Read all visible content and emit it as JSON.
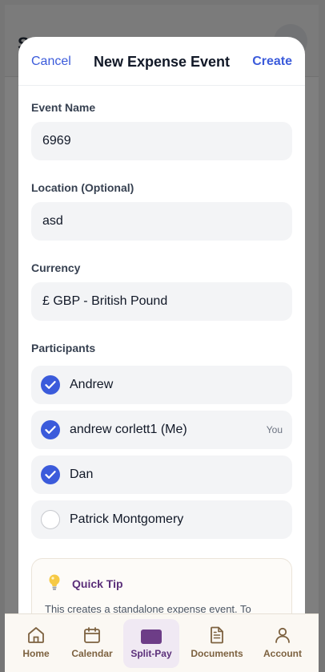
{
  "background": {
    "title": "Split-Pay"
  },
  "header": {
    "cancel": "Cancel",
    "title": "New Expense Event",
    "create": "Create"
  },
  "form": {
    "event_name": {
      "label": "Event Name",
      "value": "6969"
    },
    "location": {
      "label": "Location (Optional)",
      "value": "asd"
    },
    "currency": {
      "label": "Currency",
      "value": "£ GBP - British Pound"
    }
  },
  "participants": {
    "label": "Participants",
    "items": [
      {
        "name": "Andrew",
        "checked": true,
        "badge": ""
      },
      {
        "name": "andrew corlett1 (Me)",
        "checked": true,
        "badge": "You"
      },
      {
        "name": "Dan",
        "checked": true,
        "badge": ""
      },
      {
        "name": "Patrick Montgomery",
        "checked": false,
        "badge": ""
      }
    ]
  },
  "tip": {
    "title": "Quick Tip",
    "text": "This creates a standalone expense event. To"
  },
  "tabs": [
    {
      "label": "Home",
      "icon": "home-icon"
    },
    {
      "label": "Calendar",
      "icon": "calendar-icon"
    },
    {
      "label": "Split-Pay",
      "icon": "wallet-icon",
      "active": true
    },
    {
      "label": "Documents",
      "icon": "document-icon"
    },
    {
      "label": "Account",
      "icon": "user-icon"
    }
  ],
  "colors": {
    "accent": "#3b5bdb",
    "brand": "#5b2f7a",
    "tab_text": "#7d6240"
  }
}
